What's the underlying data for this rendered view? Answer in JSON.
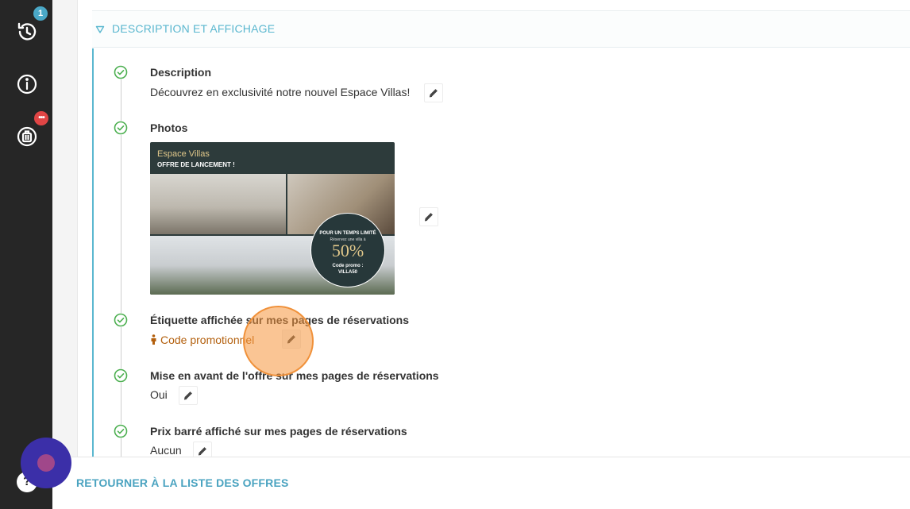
{
  "sidebar": {
    "history_badge": "1",
    "bag_badge": "•••",
    "help_label": "?"
  },
  "section": {
    "title": "DESCRIPTION ET AFFICHAGE"
  },
  "items": {
    "description": {
      "label": "Description",
      "value": "Découvrez en exclusivité notre nouvel Espace Villas!"
    },
    "photos": {
      "label": "Photos",
      "image": {
        "brand": "Espace Villas",
        "offer": "OFFRE DE LANCEMENT !",
        "roundel_line1": "POUR UN TEMPS LIMITÉ",
        "roundel_line2": "Réservez une villa à",
        "roundel_percent": "50%",
        "roundel_line3": "Code promo :",
        "roundel_code": "VILLA50"
      }
    },
    "etiquette": {
      "label": "Étiquette affichée sur mes pages de réservations",
      "value": "Code promotionnel"
    },
    "mise_en_avant": {
      "label": "Mise en avant de l'offre sur mes pages de réservations",
      "value": "Oui"
    },
    "prix_barre": {
      "label": "Prix barré affiché sur mes pages de réservations",
      "value": "Aucun"
    }
  },
  "footer": {
    "back_label": "RETOURNER À LA LISTE DES OFFRES"
  },
  "colors": {
    "accent": "#5ab7cf",
    "check_green": "#4caf50",
    "promo_orange": "#b3600e",
    "sidebar": "#262626",
    "chat": "#3b2fa8"
  }
}
